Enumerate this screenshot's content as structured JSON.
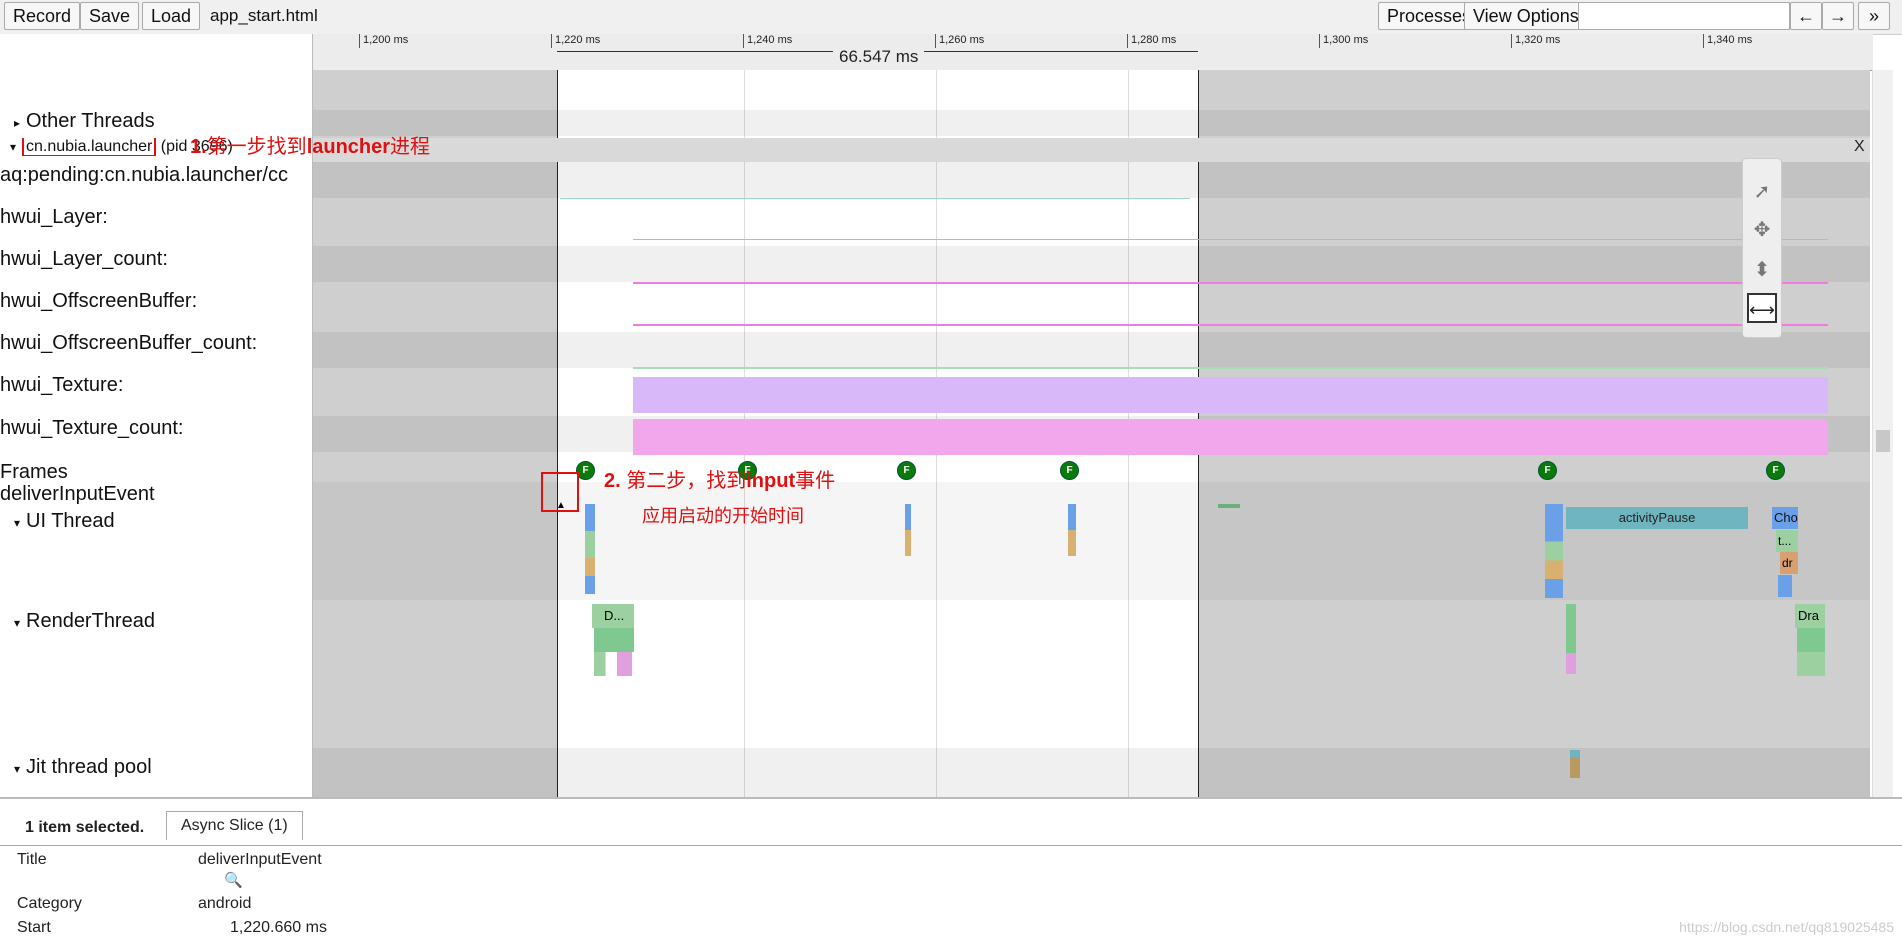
{
  "toolbar": {
    "record": "Record",
    "save": "Save",
    "load": "Load",
    "filename": "app_start.html",
    "processes": "Processes",
    "view_options": "View Options",
    "back_arrow": "←",
    "forward_arrow": "→",
    "more": "»"
  },
  "ruler": {
    "ticks": [
      "1,200 ms",
      "1,220 ms",
      "1,240 ms",
      "1,260 ms",
      "1,280 ms",
      "1,300 ms",
      "1,320 ms",
      "1,340 ms"
    ],
    "selection_duration": "66.547 ms"
  },
  "tracks": {
    "other_threads": "Other Threads",
    "process_name": "cn.nubia.launcher",
    "process_pid": "(pid 3696)",
    "close": "X",
    "rows": [
      "aq:pending:cn.nubia.launcher/cc",
      "hwui_Layer:",
      "hwui_Layer_count:",
      "hwui_OffscreenBuffer:",
      "hwui_OffscreenBuffer_count:",
      "hwui_Texture:",
      "hwui_Texture_count:",
      "Frames",
      "deliverInputEvent"
    ],
    "ui_thread": "UI Thread",
    "render_thread": "RenderThread",
    "jit_pool": "Jit thread pool",
    "frame_marker": "F",
    "slices": {
      "activity_pause": "activityPause",
      "cho": "Cho",
      "t": "t...",
      "dr": "dr",
      "d": "D...",
      "dra": "Dra"
    }
  },
  "annotations": {
    "step1_num": "1.",
    "step1_text_a": "第一步找到",
    "step1_bold": "launcher",
    "step1_text_b": "进程",
    "step2_num": "2.",
    "step2_text_a": "第二步，找到",
    "step2_bold": "input",
    "step2_text_b": "事件",
    "step2_line2": "应用启动的开始时间"
  },
  "details": {
    "summary": "1 item selected.",
    "tab": "Async Slice (1)",
    "title_label": "Title",
    "title_value": "deliverInputEvent",
    "category_label": "Category",
    "category_value": "android",
    "start_label": "Start",
    "start_value": "1,220.660 ms",
    "watermark": "https://blog.csdn.net/qq819025485"
  }
}
